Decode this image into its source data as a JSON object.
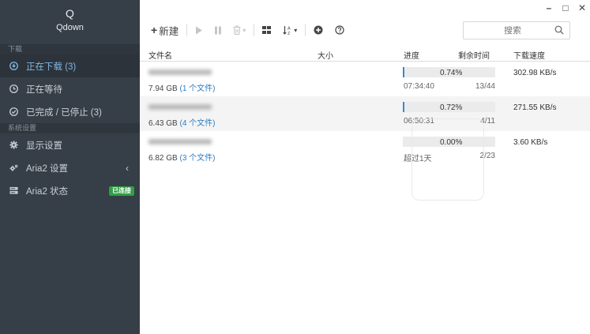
{
  "app": {
    "logo_letter": "Q",
    "name": "Qdown"
  },
  "sidebar": {
    "section_download": "下载",
    "items": [
      {
        "label": "正在下载 (3)",
        "icon": "download-circle-icon",
        "active": true
      },
      {
        "label": "正在等待",
        "icon": "clock-icon",
        "active": false
      },
      {
        "label": "已完成 / 已停止 (3)",
        "icon": "check-circle-icon",
        "active": false
      }
    ],
    "section_settings": "系统设置",
    "settings_items": [
      {
        "label": "显示设置",
        "icon": "gear-icon"
      },
      {
        "label": "Aria2 设置",
        "icon": "gears-icon"
      },
      {
        "label": "Aria2 状态",
        "icon": "server-icon",
        "badge": "已连接"
      }
    ]
  },
  "toolbar": {
    "new_label": "新建"
  },
  "search": {
    "placeholder": "搜索"
  },
  "table": {
    "headers": {
      "name": "文件名",
      "size": "大小",
      "progress": "进度",
      "remaining": "剩余时间",
      "speed": "下载速度"
    },
    "rows": [
      {
        "name": "",
        "size": "7.94 GB",
        "files": "(1 个文件)",
        "progress": 0.74,
        "percent": "0.74%",
        "eta": "07:34:40",
        "connections": "13/44",
        "speed": "302.98 KB/s"
      },
      {
        "name": "",
        "size": "6.43 GB",
        "files": "(4 个文件)",
        "progress": 0.72,
        "percent": "0.72%",
        "eta": "06:50:31",
        "connections": "4/11",
        "speed": "271.55 KB/s"
      },
      {
        "name": "",
        "size": "6.82 GB",
        "files": "(3 个文件)",
        "progress": 0.0,
        "percent": "0.00%",
        "eta": "超过1天",
        "connections": "2/23",
        "speed": "3.60 KB/s"
      }
    ]
  },
  "colors": {
    "sidebar_bg": "#363e47",
    "active_text": "#7fb7e6",
    "accent": "#3a86d4",
    "badge_bg": "#2ea043"
  }
}
